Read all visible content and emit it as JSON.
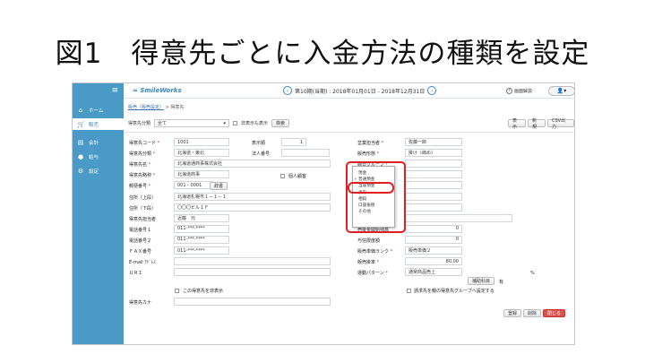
{
  "slide_title": "図1　得意先ごとに入金方法の種類を設定",
  "app": {
    "logo": "SmileWorks",
    "period": "第10期(当期) : 2018年01月01日 - 2018年12月31日",
    "help": "画面解説",
    "user_icon": "👤▾"
  },
  "sidebar": {
    "items": [
      {
        "icon": "home-icon",
        "glyph": "⌂",
        "label": "ホーム"
      },
      {
        "icon": "cart-icon",
        "glyph": "🛒",
        "label": "販売"
      },
      {
        "icon": "ledger-icon",
        "glyph": "▤",
        "label": "会計"
      },
      {
        "icon": "money-icon",
        "glyph": "●",
        "label": "給与"
      },
      {
        "icon": "gear-icon",
        "glyph": "⚙",
        "label": "設定"
      }
    ]
  },
  "breadcrumb": {
    "link": "販売（販売設定）",
    "current": "> 得意先"
  },
  "filter": {
    "class_label": "得意先分類",
    "class_value": "全て",
    "hidden_label": "非表示も表示",
    "search_button": "検索"
  },
  "top_buttons": [
    "表示",
    "新規",
    "CSV出力"
  ],
  "form": {
    "col1": [
      {
        "label": "得意先コード",
        "req": true,
        "value": "1001"
      },
      {
        "label": "得意先分類",
        "req": true,
        "value": "北海道・東北"
      },
      {
        "label": "得意先名",
        "req": true,
        "value": "北海道通商事株式会社"
      },
      {
        "label": "得意先略称",
        "req": true,
        "value": "北海道商事"
      },
      {
        "label": "郵便番号",
        "req": true,
        "value": "001 - 0001"
      },
      {
        "label": "住所（上段）",
        "req": false,
        "value": "北海道札幌市１－１－１"
      },
      {
        "label": "住所（下段）",
        "req": false,
        "value": "〇〇〇ビル１Ｆ"
      },
      {
        "label": "得意先担当者",
        "req": false,
        "value": "近藤　元"
      },
      {
        "label": "電話番号１",
        "req": false,
        "value": "011-***-****"
      },
      {
        "label": "電話番号２",
        "req": false,
        "value": "011-***-****"
      },
      {
        "label": "ＦＡＸ番号",
        "req": false,
        "value": "011-***-****"
      },
      {
        "label": "E-mail ｱﾄﾞﾚｽ",
        "req": false,
        "value": ""
      },
      {
        "label": "ＵＲＩ",
        "req": false,
        "value": ""
      },
      {
        "label": "得意先カナ",
        "req": false,
        "value": ""
      }
    ],
    "display_order_label": "表示順",
    "display_order": "1",
    "dest_label": "法人番号",
    "personal_label": "個人顧客",
    "zip_button": "辞書",
    "hide_label": "この得意先を非表示",
    "col3": [
      {
        "label": "営業担当者",
        "req": true,
        "value": "佐藤一郎"
      },
      {
        "label": "販売形態",
        "req": true,
        "value": "掛け（締め）"
      },
      {
        "label": "締日グループ",
        "req": true,
        "value": ""
      },
      {
        "label": "入金条件",
        "req": true,
        "value": ""
      },
      {
        "label": "入金方法",
        "req": true,
        "value": ""
      },
      {
        "label": "消費税計算方法",
        "req": true,
        "value": ""
      },
      {
        "label": "端数処理",
        "req": true,
        "value": ""
      },
      {
        "label": "納期",
        "req": false,
        "value": ""
      },
      {
        "label": "売掛金開始残高",
        "req": false,
        "value": "0"
      },
      {
        "label": "与信限度額",
        "req": false,
        "value": "0"
      },
      {
        "label": "販売単価ランク",
        "req": true,
        "value": "販売単価２"
      },
      {
        "label": "販売掛率",
        "req": true,
        "value": "80.00"
      },
      {
        "label": "運動パターン",
        "req": true,
        "value": "通常商品売上"
      }
    ],
    "percent": "%",
    "pattern_button": "補助科目",
    "pattern_suffix": "有",
    "billing_label": "請求先を親の得意先グループへ設定する"
  },
  "dropdown": {
    "options": [
      "現金",
      "普通預金",
      "当座預金",
      "手形",
      "相殺",
      "口座振替",
      "その他"
    ],
    "checked_index": 1
  },
  "bottom_buttons": [
    "登録",
    "削除",
    "閉じる"
  ]
}
